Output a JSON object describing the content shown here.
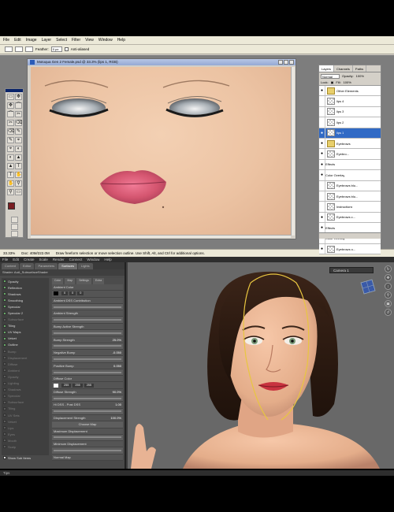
{
  "photoshop": {
    "menu": [
      "File",
      "Edit",
      "Image",
      "Layer",
      "Select",
      "Filter",
      "View",
      "Window",
      "Help"
    ],
    "options": {
      "feather_label": "Feather:",
      "feather_value": "0 px",
      "antialias_label": "Anti-aliased"
    },
    "document": {
      "title": "Motoqua Gen 2 Female.psd @ 33.3% (lips 1, RGB)"
    },
    "layers_panel": {
      "tabs": [
        "Layers",
        "Channels",
        "Paths"
      ],
      "blend_mode": "Normal",
      "opacity_label": "Opacity:",
      "opacity_value": "100%",
      "lock_label": "Lock:",
      "fill_label": "Fill:",
      "fill_value": "100%",
      "rows": [
        {
          "name": "Other Elements",
          "kind": "folder",
          "visible": true
        },
        {
          "name": "lips 4",
          "kind": "layer",
          "visible": false
        },
        {
          "name": "lips 3",
          "kind": "layer",
          "visible": false
        },
        {
          "name": "lips 2",
          "kind": "layer",
          "visible": false
        },
        {
          "name": "lips 1",
          "kind": "layer",
          "visible": true,
          "selected": true
        },
        {
          "name": "Eyebrows",
          "kind": "folder",
          "visible": true
        },
        {
          "name": "Eyebro...",
          "kind": "layer",
          "visible": true
        },
        {
          "name": "Effects",
          "kind": "fx",
          "visible": true
        },
        {
          "name": "Color Overlay",
          "kind": "fx",
          "visible": true
        },
        {
          "name": "Eyebrows blu...",
          "kind": "layer",
          "visible": false
        },
        {
          "name": "Eyebrows blu...",
          "kind": "layer",
          "visible": false
        },
        {
          "name": "Instructions",
          "kind": "text",
          "visible": false
        },
        {
          "name": "Eyebrows c...",
          "kind": "layer",
          "visible": true
        },
        {
          "name": "Effects",
          "kind": "fx",
          "visible": true
        },
        {
          "name": "Color Overlay",
          "kind": "fx",
          "visible": true
        },
        {
          "name": "Eyebrows o...",
          "kind": "layer",
          "visible": true
        }
      ]
    },
    "status": {
      "zoom": "33.33%",
      "doc_size": "Doc: 40M/222.0M",
      "hint": "Draw freeform selection or move selection outline. Use Shift, Alt, and Ctrl for additional options."
    }
  },
  "daz": {
    "menu": [
      "File",
      "Edit",
      "Create",
      "Scale",
      "Render",
      "Connect",
      "Window",
      "Help"
    ],
    "tabs": [
      "Content",
      "Editor",
      "Parameters",
      "Surfaces",
      "Lights"
    ],
    "active_tab": "Surfaces",
    "shader_label": "Shader: AoA_SubsurfaceShader",
    "properties": [
      {
        "name": "Opacity",
        "on": true
      },
      {
        "name": "Reflection",
        "on": true
      },
      {
        "name": "Shadows",
        "on": true
      },
      {
        "name": "Smoothing",
        "on": true
      },
      {
        "name": "Specular",
        "on": true
      },
      {
        "name": "Specular 2",
        "on": true
      },
      {
        "name": "Subsurface",
        "on": false
      },
      {
        "name": "Tiling",
        "on": true
      },
      {
        "name": "UV Maps",
        "on": true
      },
      {
        "name": "Velvet",
        "on": true
      },
      {
        "name": "Outline",
        "on": true
      },
      {
        "name": "Bump",
        "on": false
      },
      {
        "name": "Displacement",
        "on": false
      },
      {
        "name": "Diffuse",
        "on": false
      },
      {
        "name": "Ambient",
        "on": false
      },
      {
        "name": "Opacity",
        "on": false
      },
      {
        "name": "Lighting",
        "on": false
      },
      {
        "name": "Shadows",
        "on": false
      },
      {
        "name": "Specular",
        "on": false
      },
      {
        "name": "Subsurface",
        "on": false
      },
      {
        "name": "Tiling",
        "on": false
      },
      {
        "name": "UV Sets",
        "on": false
      },
      {
        "name": "Velvet",
        "on": false
      },
      {
        "name": "Lips",
        "on": false
      },
      {
        "name": "Eyes",
        "on": false
      },
      {
        "name": "Mouth",
        "on": false
      },
      {
        "name": "Scalp",
        "on": false
      }
    ],
    "detail_subtabs": [
      "Color",
      "Map",
      "Settings",
      "Extra"
    ],
    "detail_rows": [
      {
        "label": "Ambient Color",
        "value": "",
        "type": "header"
      },
      {
        "label": "0",
        "value": "0",
        "extra": "0",
        "type": "rgb"
      },
      {
        "label": "Ambient DSS Contribution",
        "value": "",
        "type": "header"
      },
      {
        "label": "",
        "value": "",
        "type": "slider"
      },
      {
        "label": "Ambient Strength",
        "value": "",
        "type": "header"
      },
      {
        "label": "",
        "value": "",
        "type": "slider"
      },
      {
        "label": "Bump Active Strength",
        "value": "",
        "type": "header"
      },
      {
        "label": "",
        "value": "",
        "type": "slider"
      },
      {
        "label": "Bump Strength",
        "value": "25.0%",
        "type": "value"
      },
      {
        "label": "",
        "value": "",
        "type": "slider"
      },
      {
        "label": "Negative Bump",
        "value": "-0.050",
        "type": "value"
      },
      {
        "label": "",
        "value": "",
        "type": "slider"
      },
      {
        "label": "Positive Bump",
        "value": "0.050",
        "type": "value"
      },
      {
        "label": "",
        "value": "",
        "type": "slider"
      },
      {
        "label": "Diffuse Color",
        "value": "",
        "type": "header"
      },
      {
        "label": "255",
        "value": "255",
        "extra": "255",
        "type": "rgb"
      },
      {
        "label": "Diffuse Strength",
        "value": "90.0%",
        "type": "value"
      },
      {
        "label": "",
        "value": "",
        "type": "slider"
      },
      {
        "label": "Hi DSS - Post DSS",
        "value": "1.00",
        "type": "value"
      },
      {
        "label": "",
        "value": "",
        "type": "slider"
      },
      {
        "label": "Displacement Strength",
        "value": "100.0%",
        "type": "value"
      },
      {
        "label": "Choose Map",
        "value": "",
        "type": "button"
      },
      {
        "label": "Maximum Displacement",
        "value": "",
        "type": "header"
      },
      {
        "label": "",
        "value": "",
        "type": "slider"
      },
      {
        "label": "Minimum Displacement",
        "value": "",
        "type": "header"
      },
      {
        "label": "",
        "value": "",
        "type": "slider"
      },
      {
        "label": "Normal Map",
        "value": "",
        "type": "header"
      }
    ],
    "show_sub_items": "Show Sub Items",
    "camera": "Camera 1",
    "tips": "Tips"
  },
  "colors": {
    "ps_bg": "#7d7d7d",
    "daz_viewport": "#686868",
    "selection": "#316ac5"
  }
}
